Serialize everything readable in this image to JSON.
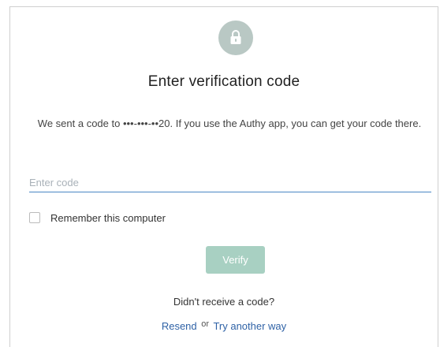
{
  "header": {
    "icon": "lock-icon",
    "icon_bg_color": "#b9c8c4"
  },
  "title": "Enter verification code",
  "description": "We sent a code to •••-•••-••20. If you use the Authy app, you can get your code there.",
  "code_input": {
    "placeholder": "Enter code",
    "value": ""
  },
  "remember": {
    "label": "Remember this computer",
    "checked": false
  },
  "verify_button": {
    "label": "Verify",
    "color": "#a8d0c2"
  },
  "resend_section": {
    "prompt": "Didn't receive a code?",
    "resend_label": "Resend",
    "or_label": "or",
    "try_another_label": "Try another way"
  },
  "colors": {
    "link": "#2f62a6",
    "input_underline": "#4a86c5"
  }
}
